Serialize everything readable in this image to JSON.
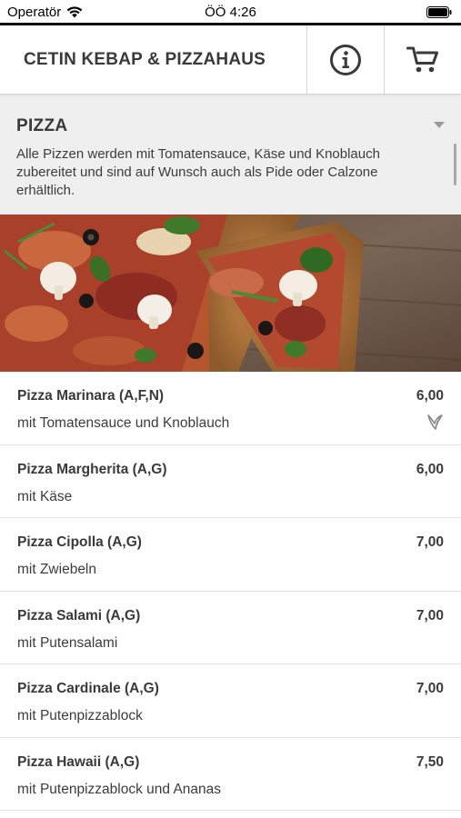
{
  "status_bar": {
    "carrier": "Operatör",
    "time": "ÖÖ 4:26"
  },
  "header": {
    "title": "CETIN KEBAP & PIZZAHAUS",
    "info_icon": "info-circle-icon",
    "cart_icon": "shopping-cart-icon"
  },
  "category": {
    "title": "PIZZA",
    "description": "Alle Pizzen werden mit Tomatensauce, Käse und Knoblauch zubereitet und sind auf Wunsch auch als Pide oder Calzone erhältlich."
  },
  "products": [
    {
      "name": "Pizza Marinara (A,F,N)",
      "price": "6,00",
      "description": "mit Tomatensauce und Knoblauch",
      "icon": "vegan-leaf-icon"
    },
    {
      "name": "Pizza Margherita (A,G)",
      "price": "6,00",
      "description": "mit Käse"
    },
    {
      "name": "Pizza Cipolla (A,G)",
      "price": "7,00",
      "description": "mit Zwiebeln"
    },
    {
      "name": "Pizza Salami (A,G)",
      "price": "7,00",
      "description": "mit Putensalami"
    },
    {
      "name": "Pizza Cardinale (A,G)",
      "price": "7,00",
      "description": "mit Putenpizzablock"
    },
    {
      "name": "Pizza Hawaii (A,G)",
      "price": "7,50",
      "description": "mit Putenpizzablock und Ananas"
    }
  ],
  "colors": {
    "header_text": "#3a3a3a",
    "panel_bg": "#efefef",
    "divider": "#e0e0e0"
  }
}
